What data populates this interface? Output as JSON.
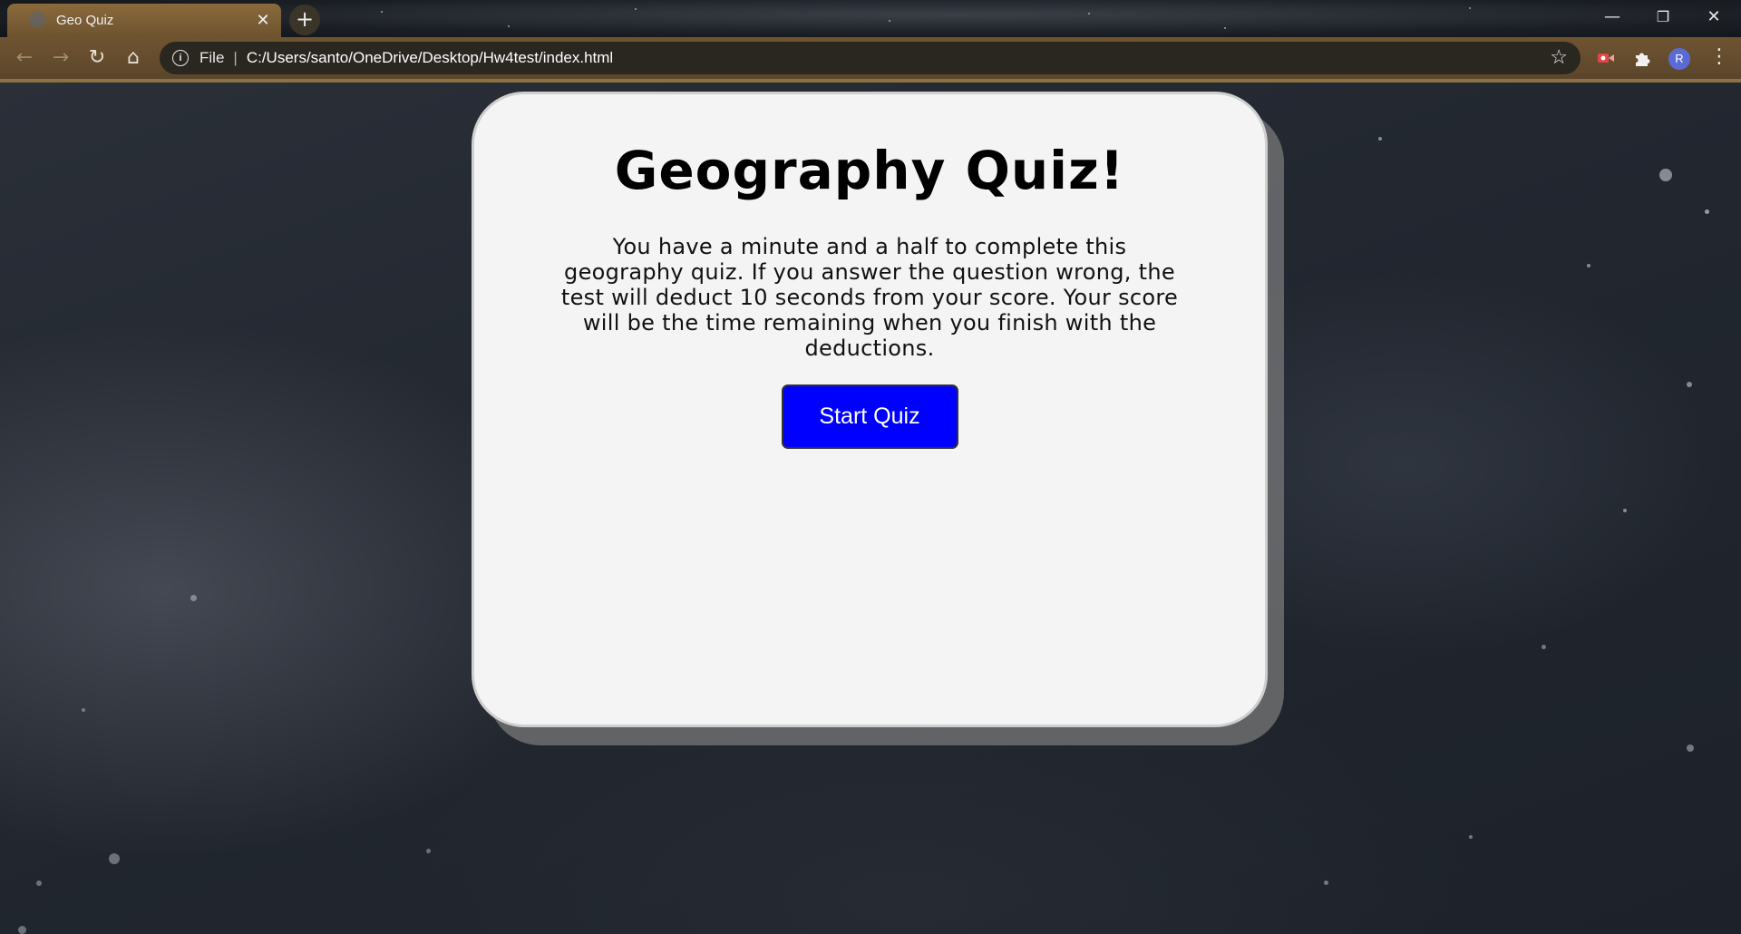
{
  "browser": {
    "tab": {
      "title": "Geo Quiz",
      "close_glyph": "✕"
    },
    "new_tab_glyph": "+",
    "window_controls": {
      "minimize": "—",
      "restore": "❐",
      "close": "✕"
    },
    "nav": {
      "back": "←",
      "forward": "→",
      "reload": "↻",
      "home": "⌂"
    },
    "address": {
      "scheme": "File",
      "separator": "|",
      "url": "C:/Users/santo/OneDrive/Desktop/Hw4test/index.html"
    },
    "bookmark_glyph": "☆",
    "profile_initial": "R",
    "menu_glyph": "⋮"
  },
  "page": {
    "title": "Geography Quiz!",
    "instructions": "You have a minute and a half to complete this geography quiz. If you answer the question wrong, the test will deduct 10 seconds from your score. Your score will be the time remaining when you finish with the deductions.",
    "start_button": "Start Quiz"
  },
  "colors": {
    "card_background": "#f4f4f4",
    "start_button": "#0000ff",
    "chrome_toolbar": "#6f5431"
  }
}
